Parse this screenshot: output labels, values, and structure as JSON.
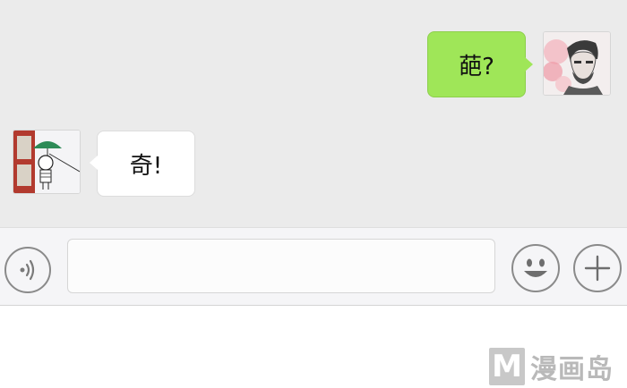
{
  "messages": [
    {
      "side": "right",
      "text": "葩?",
      "avatar": "photo-avatar-man"
    },
    {
      "side": "left",
      "text": "奇!",
      "avatar": "cartoon-avatar-girl-umbrella"
    }
  ],
  "input_bar": {
    "value": "",
    "voice_icon": "voice-icon",
    "emoji_icon": "emoji-icon",
    "plus_icon": "plus-icon"
  },
  "watermark": {
    "logo_letter": "M",
    "text": "漫画岛"
  },
  "colors": {
    "chat_background": "#ebebeb",
    "sent_bubble": "#9fe658",
    "received_bubble": "#ffffff"
  }
}
